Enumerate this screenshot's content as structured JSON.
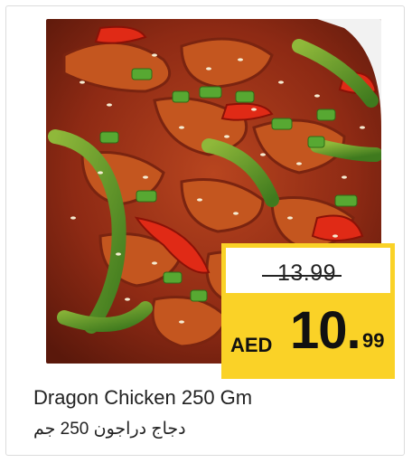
{
  "product": {
    "name_en": "Dragon Chicken 250 Gm",
    "name_ar": "دجاج دراجون 250 جم",
    "image_alt": "dragon-chicken-photo"
  },
  "price": {
    "old": "13.99",
    "currency": "AED",
    "new_integer": "10.",
    "new_decimal": "99"
  },
  "colors": {
    "price_badge": "#fad227",
    "card_border": "#dcdcdc",
    "text": "#222222"
  }
}
